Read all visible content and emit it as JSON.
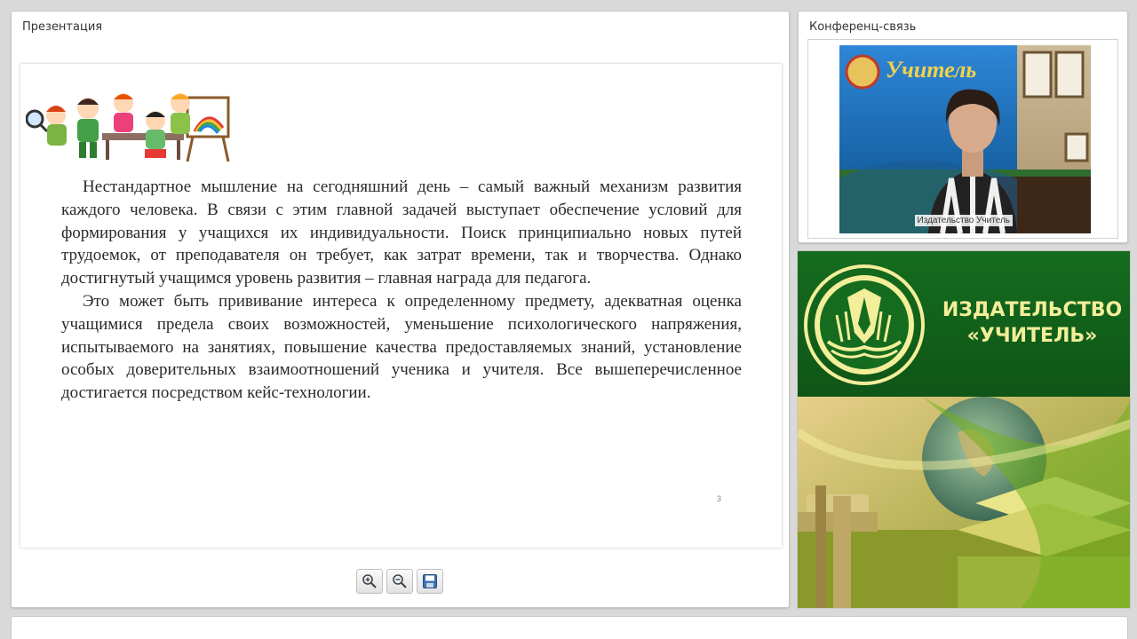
{
  "presentation": {
    "title": "Презентация",
    "slide": {
      "paragraphs": [
        "Нестандартное мышление на сегодняшний день – самый важный механизм развития каждого человека. В связи с этим главной задачей выступает обеспечение условий для формирования у учащихся их индивидуальности. Поиск принципиально новых путей трудоемок, от преподавателя он требует, как затрат времени, так и творчества. Однако достигнутый учащимся уровень развития – главная награда для педагога.",
        "Это может быть прививание интереса к определенному предмету, адекватная оценка учащимися предела своих возможностей, уменьшение психологического напряжения, испытываемого на занятиях, повышение качества предоставляемых знаний, установление особых доверительных взаимоотношений ученика и учителя. Все вышеперечисленное достигается посредством кейс-технологии."
      ],
      "page_number": "3"
    },
    "toolbar": {
      "zoom_in_icon": "zoom-in-icon",
      "zoom_out_icon": "zoom-out-icon",
      "save_icon": "floppy-disk-icon"
    }
  },
  "conference": {
    "title": "Конференц-связь",
    "speaker_caption": "Издательство Учитель",
    "banner_text": "Учитель"
  },
  "brand": {
    "line1": "ИЗДАТЕЛЬСТВО",
    "line2": "«УЧИТЕЛЬ»",
    "colors": {
      "green": "#156c1e",
      "gold": "#f3ee9a"
    }
  }
}
